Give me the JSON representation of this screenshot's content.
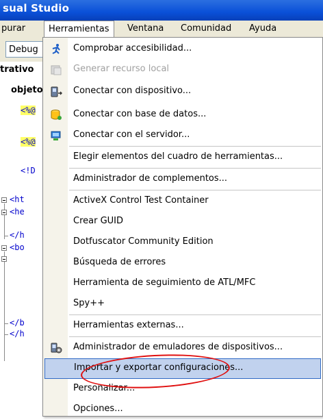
{
  "window": {
    "title": "sual Studio"
  },
  "menubar": {
    "items": [
      {
        "label": "purar"
      },
      {
        "label": "Herramientas"
      },
      {
        "label": "Ventana"
      },
      {
        "label": "Comunidad"
      },
      {
        "label": "Ayuda"
      }
    ]
  },
  "toolbar": {
    "debug_label": "Debug"
  },
  "left": {
    "panel_title": "trativo",
    "tab_label": "objeto"
  },
  "code": {
    "lines": [
      "<%@",
      "<%@",
      "<!D",
      "<ht",
      "<he",
      "</h",
      "<bo",
      "</b",
      "</h"
    ]
  },
  "tools_menu": {
    "items": [
      {
        "label": "Comprobar accesibilidad...",
        "icon": "accessibility-icon",
        "enabled": true
      },
      {
        "label": "Generar recurso local",
        "icon": "resource-icon",
        "enabled": false
      },
      {
        "label": "Conectar con dispositivo...",
        "icon": "device-icon",
        "enabled": true
      },
      {
        "label": "Conectar con base de datos...",
        "icon": "database-icon",
        "enabled": true
      },
      {
        "label": "Conectar con el servidor...",
        "icon": "server-icon",
        "enabled": true
      },
      {
        "label": "Elegir elementos del cuadro de herramientas...",
        "enabled": true
      },
      {
        "label": "Administrador de complementos...",
        "enabled": true
      },
      {
        "label": "ActiveX Control Test Container",
        "enabled": true
      },
      {
        "label": "Crear GUID",
        "enabled": true
      },
      {
        "label": "Dotfuscator Community Edition",
        "enabled": true
      },
      {
        "label": "Búsqueda de errores",
        "enabled": true
      },
      {
        "label": "Herramienta de seguimiento de ATL/MFC",
        "enabled": true
      },
      {
        "label": "Spy++",
        "enabled": true
      },
      {
        "label": "Herramientas externas...",
        "enabled": true
      },
      {
        "label": "Administrador de emuladores de dispositivos...",
        "icon": "emulator-icon",
        "enabled": true
      },
      {
        "label": "Importar y exportar configuraciones...",
        "enabled": true,
        "selected": true
      },
      {
        "label": "Personalizar...",
        "enabled": true
      },
      {
        "label": "Opciones...",
        "enabled": true
      }
    ]
  },
  "colors": {
    "selection": "#c1d2ee",
    "annotation": "#e01010",
    "titlebar": "#0a50d8"
  }
}
